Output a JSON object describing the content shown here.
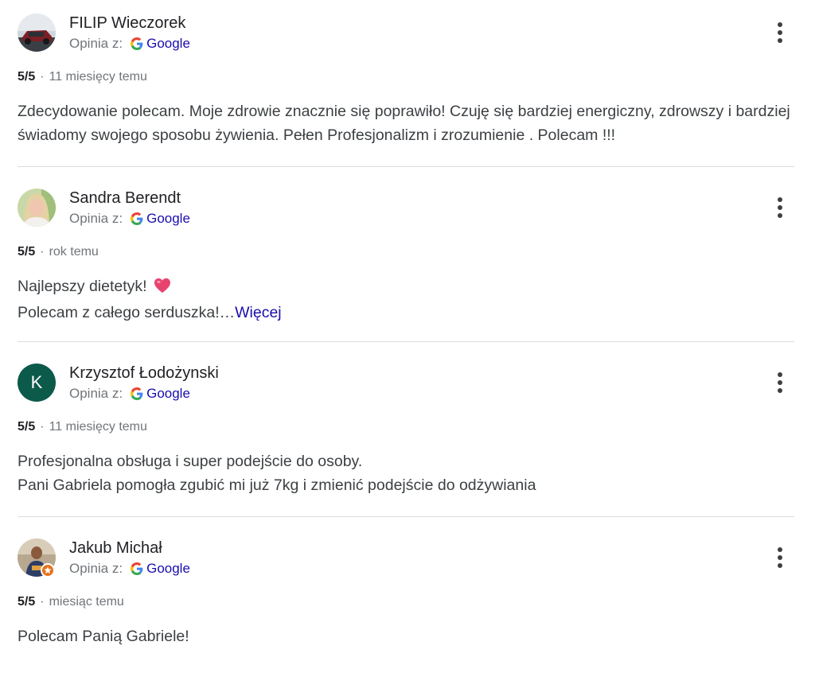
{
  "reviews": [
    {
      "author": "FILIP Wieczorek",
      "source_label": "Opinia z:",
      "source_name": "Google",
      "rating": "5/5",
      "time": "11 miesięcy temu",
      "text": "Zdecydowanie polecam. Moje zdrowie znacznie się poprawiło! Czuję się bardziej energiczny, zdrowszy i bardziej świadomy swojego sposobu żywienia. Pełen Profesjonalizm i zrozumienie . Polecam !!!"
    },
    {
      "author": "Sandra Berendt",
      "source_label": "Opinia z:",
      "source_name": "Google",
      "rating": "5/5",
      "time": "rok temu",
      "line1": "Najlepszy dietetyk!",
      "line2": "Polecam z całego serduszka!…",
      "more": "Więcej"
    },
    {
      "author": "Krzysztof Łodożynski",
      "avatar_letter": "K",
      "source_label": "Opinia z:",
      "source_name": "Google",
      "rating": "5/5",
      "time": "11 miesięcy temu",
      "line1": "Profesjonalna obsługa i super podejście do osoby.",
      "line2": "Pani Gabriela pomogła zgubić mi już 7kg i zmienić podejście do odżywiania"
    },
    {
      "author": "Jakub Michał",
      "source_label": "Opinia z:",
      "source_name": "Google",
      "rating": "5/5",
      "time": "miesiąc temu",
      "text": "Polecam Panią Gabriele!"
    }
  ],
  "separator": "·",
  "icons": {
    "menu": "more-vert-icon",
    "google": "google-g-icon",
    "heart": "heart-emoji-icon",
    "local_guide": "local-guide-star-icon"
  },
  "colors": {
    "link": "#1a0dab",
    "meta_gray": "#70757a",
    "divider": "#dadce0",
    "letter_avatar_bg": "#0b5a4a",
    "heart": "#e8436f",
    "badge": "#e8711a"
  }
}
